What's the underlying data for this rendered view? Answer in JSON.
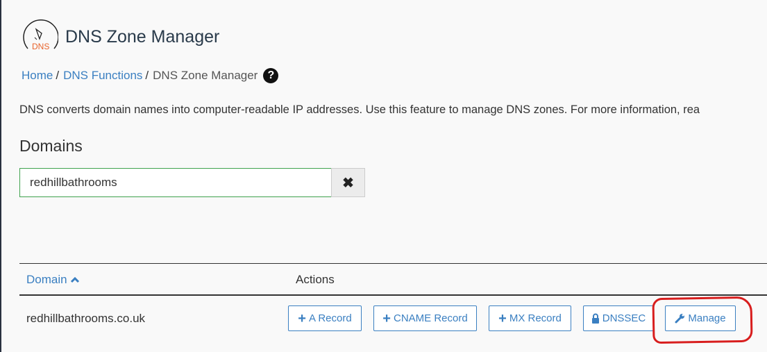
{
  "header": {
    "title": "DNS Zone Manager",
    "logo_text": "DNS",
    "logo_color": "#e8632b"
  },
  "breadcrumb": {
    "items": [
      "Home",
      "DNS Functions"
    ],
    "separator": "/",
    "current": "DNS Zone Manager",
    "help": "?"
  },
  "description": "DNS converts domain names into computer-readable IP addresses. Use this feature to manage DNS zones. For more information, rea",
  "domains": {
    "heading": "Domains",
    "search_value": "redhillbathrooms",
    "clear_icon": "times-icon"
  },
  "table": {
    "headers": {
      "domain": "Domain",
      "actions": "Actions",
      "sort": "ascending"
    },
    "rows": [
      {
        "domain": "redhillbathrooms.co.uk",
        "actions": [
          "A Record",
          "CNAME Record",
          "MX Record",
          "DNSSEC",
          "Manage"
        ]
      }
    ]
  },
  "colors": {
    "link": "#3a7fc1",
    "annotation": "#d81e1e",
    "search_border": "#3fa24e"
  }
}
